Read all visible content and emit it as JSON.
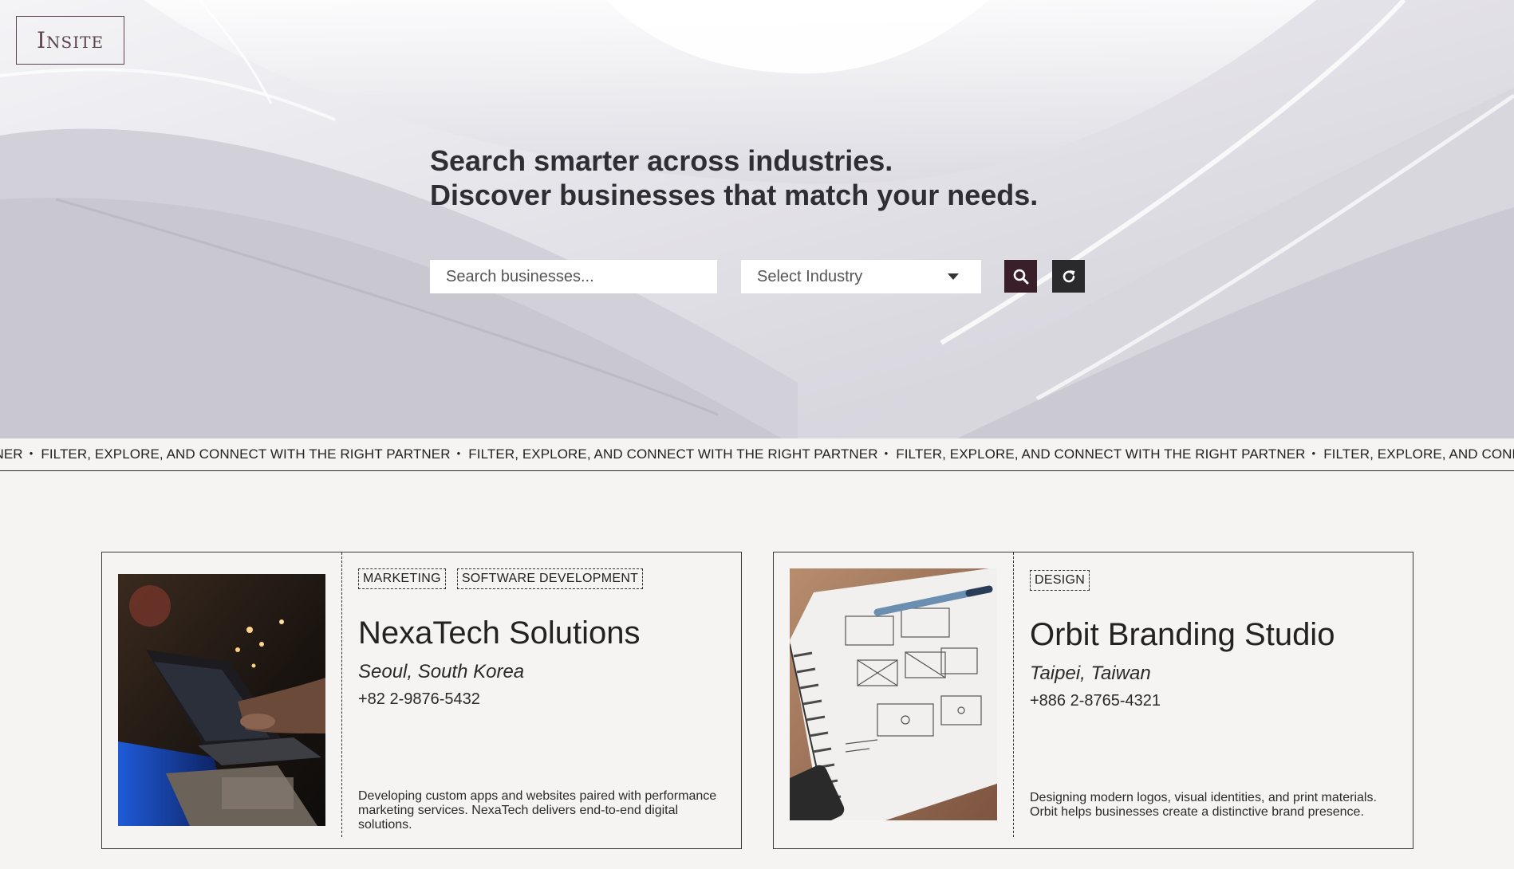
{
  "logo": "Insite",
  "hero": {
    "headline_line1": "Search smarter across industries.",
    "headline_line2": "Discover businesses that match your needs."
  },
  "search": {
    "placeholder": "Search businesses...",
    "industry_label": "Select Industry"
  },
  "icons": {
    "search": "search-icon",
    "reset": "refresh-icon",
    "dropdown": "caret-down-icon"
  },
  "ticker": {
    "lead_fragment": "TNER",
    "items": [
      "FILTER, EXPLORE, AND CONNECT WITH THE RIGHT PARTNER",
      "FILTER, EXPLORE, AND CONNECT WITH THE RIGHT PARTNER",
      "FILTER, EXPLORE, AND CONNECT WITH THE RIGHT PARTNER",
      "FILTER, EXPLORE, AND CONNECT WITH THE"
    ],
    "separator": "•"
  },
  "businesses": [
    {
      "tags": [
        "MARKETING",
        "SOFTWARE DEVELOPMENT"
      ],
      "name": "NexaTech Solutions",
      "location": "Seoul, South Korea",
      "phone": "+82 2-9876-5432",
      "description": "Developing custom apps and websites paired with performance marketing services. NexaTech delivers end-to-end digital solutions."
    },
    {
      "tags": [
        "DESIGN"
      ],
      "name": "Orbit Branding Studio",
      "location": "Taipei, Taiwan",
      "phone": "+886 2-8765-4321",
      "description": "Designing modern logos, visual identities, and print materials. Orbit helps businesses create a distinctive brand presence."
    }
  ],
  "colors": {
    "accent": "#3a1f2b",
    "background": "#f5f4f2",
    "button_dark": "#2a2a2d"
  }
}
